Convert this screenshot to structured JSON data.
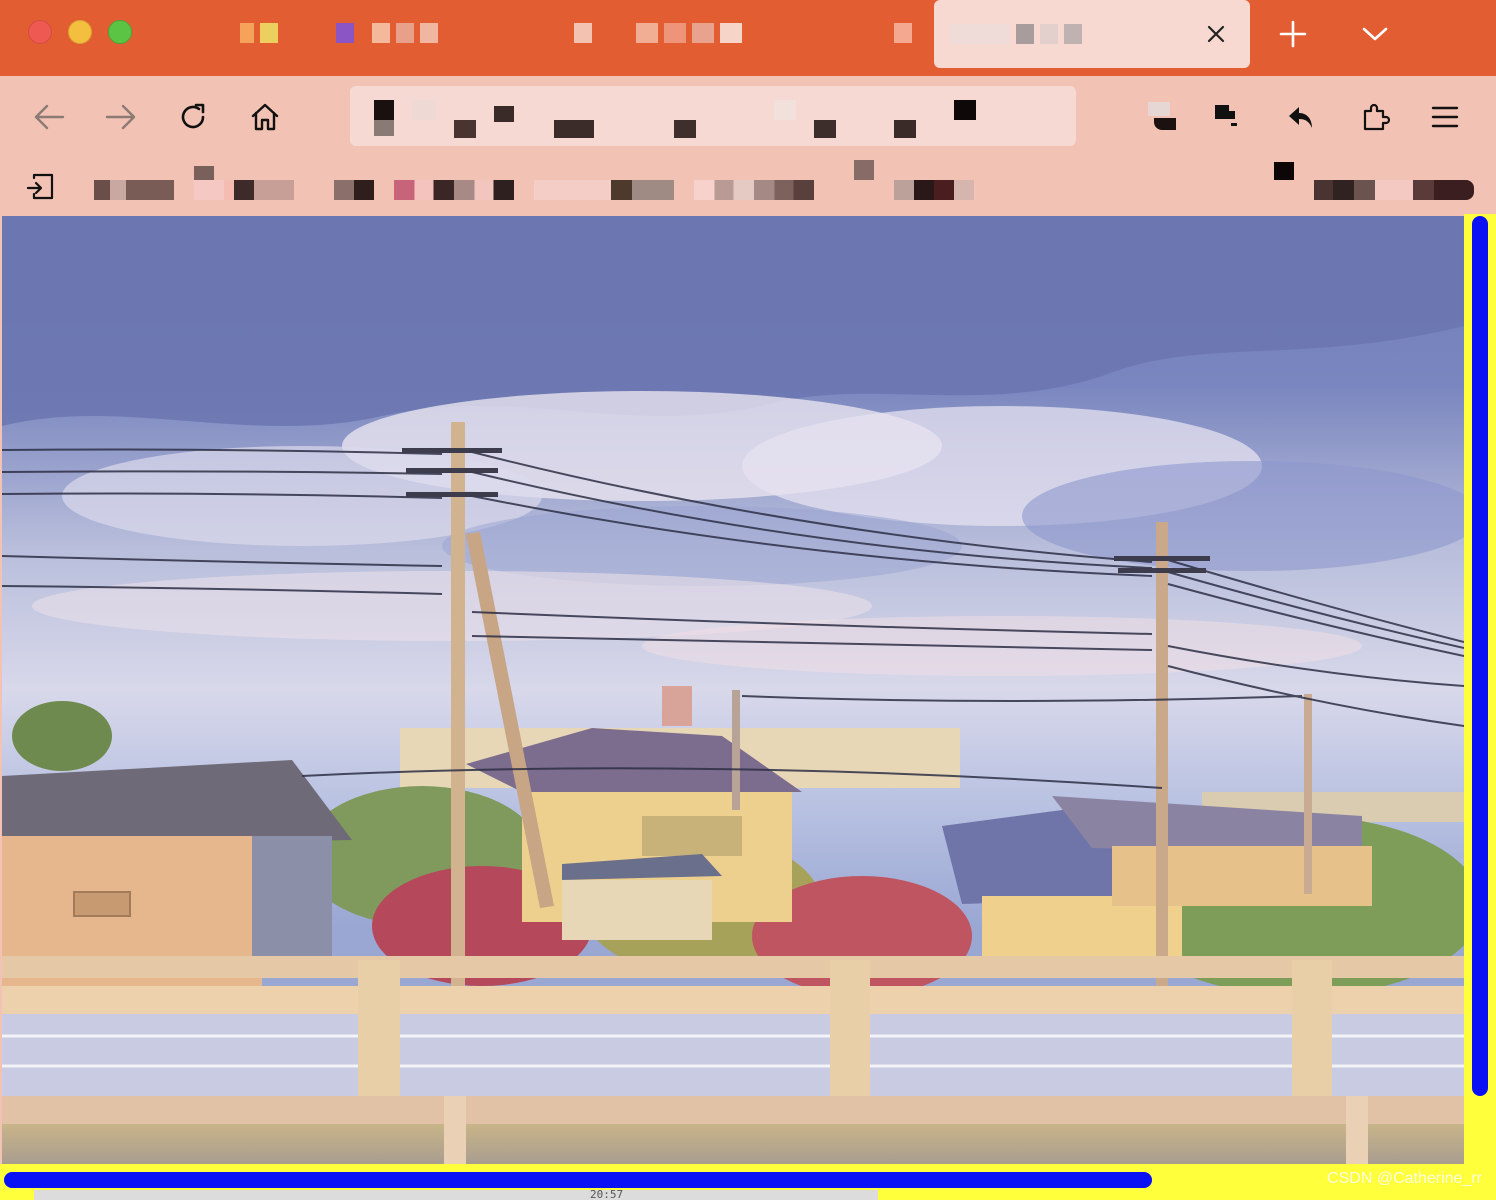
{
  "window": {
    "tabs": [
      {
        "name": "tab-1",
        "active": false
      },
      {
        "name": "tab-2",
        "active": false
      },
      {
        "name": "tab-3",
        "active": false
      },
      {
        "name": "tab-4",
        "active": false
      },
      {
        "name": "tab-5",
        "active": false
      },
      {
        "name": "tab-6",
        "active": true
      }
    ],
    "tab_close_icon": "close-icon",
    "new_tab_icon": "plus-icon",
    "tab_list_icon": "chevron-down-icon"
  },
  "toolbar": {
    "icons": [
      "back-arrow-icon",
      "forward-arrow-icon",
      "reload-icon",
      "home-icon",
      "reply-icon",
      "puzzle-icon",
      "hamburger-menu-icon"
    ]
  },
  "content": {
    "image_subject": "photo"
  },
  "scrollbars": {
    "track_color": "#ffff3c",
    "thumb_color": "#0a12f5"
  },
  "status": {
    "clock": "20:57"
  },
  "watermark": "CSDN @Catherine_rr",
  "colors": {
    "tabbar": "#e35d32",
    "toolbar": "#f2c3b4",
    "active_tab": "#f7d9d2"
  }
}
